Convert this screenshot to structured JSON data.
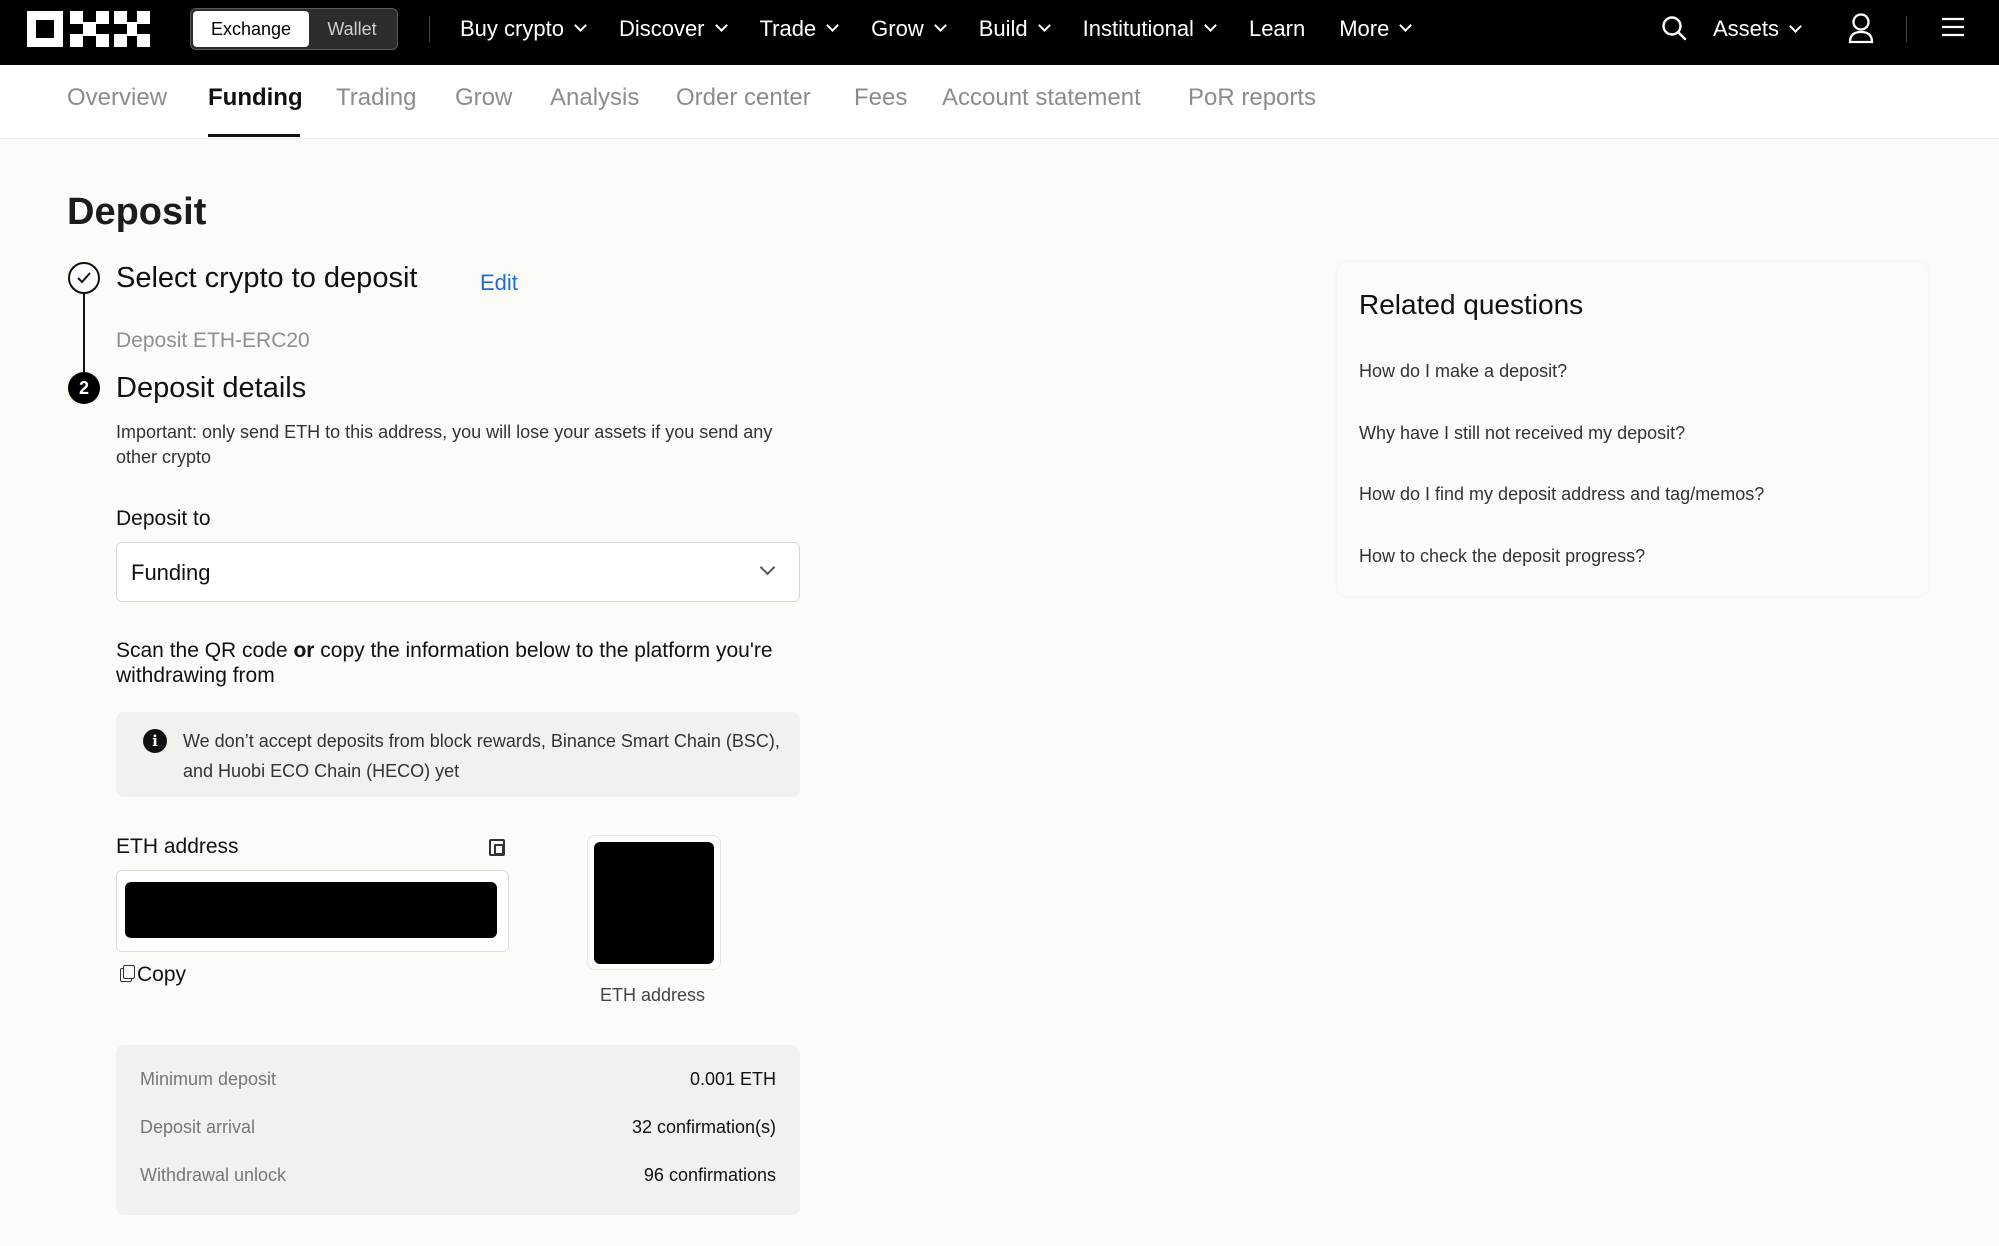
{
  "topbar": {
    "toggle": {
      "exchange": "Exchange",
      "wallet": "Wallet"
    },
    "nav": [
      {
        "label": "Buy crypto",
        "dropdown": true
      },
      {
        "label": "Discover",
        "dropdown": true
      },
      {
        "label": "Trade",
        "dropdown": true
      },
      {
        "label": "Grow",
        "dropdown": true
      },
      {
        "label": "Build",
        "dropdown": true
      },
      {
        "label": "Institutional",
        "dropdown": true
      },
      {
        "label": "Learn",
        "dropdown": false
      },
      {
        "label": "More",
        "dropdown": true
      }
    ],
    "assets_label": "Assets",
    "icons": [
      "search-icon",
      "user-icon",
      "menu-icon"
    ]
  },
  "subnav": {
    "tabs": [
      "Overview",
      "Funding",
      "Trading",
      "Grow",
      "Analysis",
      "Order center",
      "Fees",
      "Account statement",
      "PoR reports"
    ],
    "active": "Funding"
  },
  "page": {
    "title": "Deposit",
    "step1": {
      "number": "",
      "title": "Select crypto to deposit",
      "edit": "Edit",
      "sub": "Deposit ETH-ERC20"
    },
    "step2": {
      "number": "2",
      "title": "Deposit details",
      "important": "Important: only send ETH to this address, you will lose your assets if you send any other crypto",
      "deposit_to_label": "Deposit to",
      "deposit_to_value": "Funding",
      "scan_pre": "Scan the QR code ",
      "scan_bold": "or",
      "scan_post": " copy the information below to the platform you're withdrawing from",
      "notice": "We don’t accept deposits from block rewards, Binance Smart Chain (BSC), and Huobi ECO Chain (HECO) yet",
      "address_label": "ETH address",
      "copy_label": "Copy",
      "qr_caption": "ETH address",
      "info": [
        {
          "key": "Minimum deposit",
          "value": "0.001 ETH"
        },
        {
          "key": "Deposit arrival",
          "value": "32 confirmation(s)"
        },
        {
          "key": "Withdrawal unlock",
          "value": "96 confirmations"
        }
      ]
    }
  },
  "related": {
    "title": "Related questions",
    "questions": [
      "How do I make a deposit?",
      "Why have I still not received my deposit?",
      "How do I find my deposit address and tag/memos?",
      "How to check the deposit progress?"
    ]
  },
  "colors": {
    "accent_link": "#1f6fd1",
    "topbar_bg": "#000000",
    "page_bg": "#fbfbf8"
  }
}
